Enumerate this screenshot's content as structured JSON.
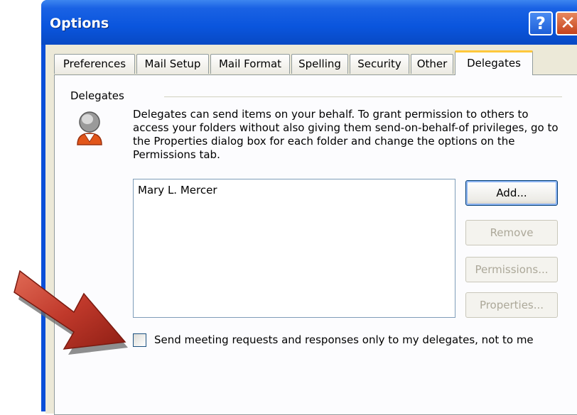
{
  "window": {
    "title": "Options",
    "help_glyph": "?",
    "close_glyph": "✕"
  },
  "tabs": [
    {
      "label": "Preferences"
    },
    {
      "label": "Mail Setup"
    },
    {
      "label": "Mail Format"
    },
    {
      "label": "Spelling"
    },
    {
      "label": "Security"
    },
    {
      "label": "Other"
    },
    {
      "label": "Delegates",
      "active": true
    }
  ],
  "delegates": {
    "group_label": "Delegates",
    "description": "Delegates can send items on your behalf. To grant permission to others to access your folders without also giving them send-on-behalf-of privileges, go to the Properties dialog box for each folder and change the options on the Permissions tab.",
    "list": [
      "Mary L. Mercer"
    ],
    "buttons": {
      "add": "Add...",
      "remove": "Remove",
      "permissions": "Permissions...",
      "properties": "Properties..."
    },
    "checkbox_label": "Send meeting requests and responses only to my delegates, not to me",
    "checkbox_checked": false
  },
  "colors": {
    "title_bar": "#0a55dd",
    "dialog_background": "#ece9d8",
    "active_tab_highlight": "#ffc83c",
    "arrow": "#c0392b"
  },
  "icons": [
    "help-icon",
    "close-icon",
    "delegates-person-icon",
    "callout-arrow-icon"
  ]
}
